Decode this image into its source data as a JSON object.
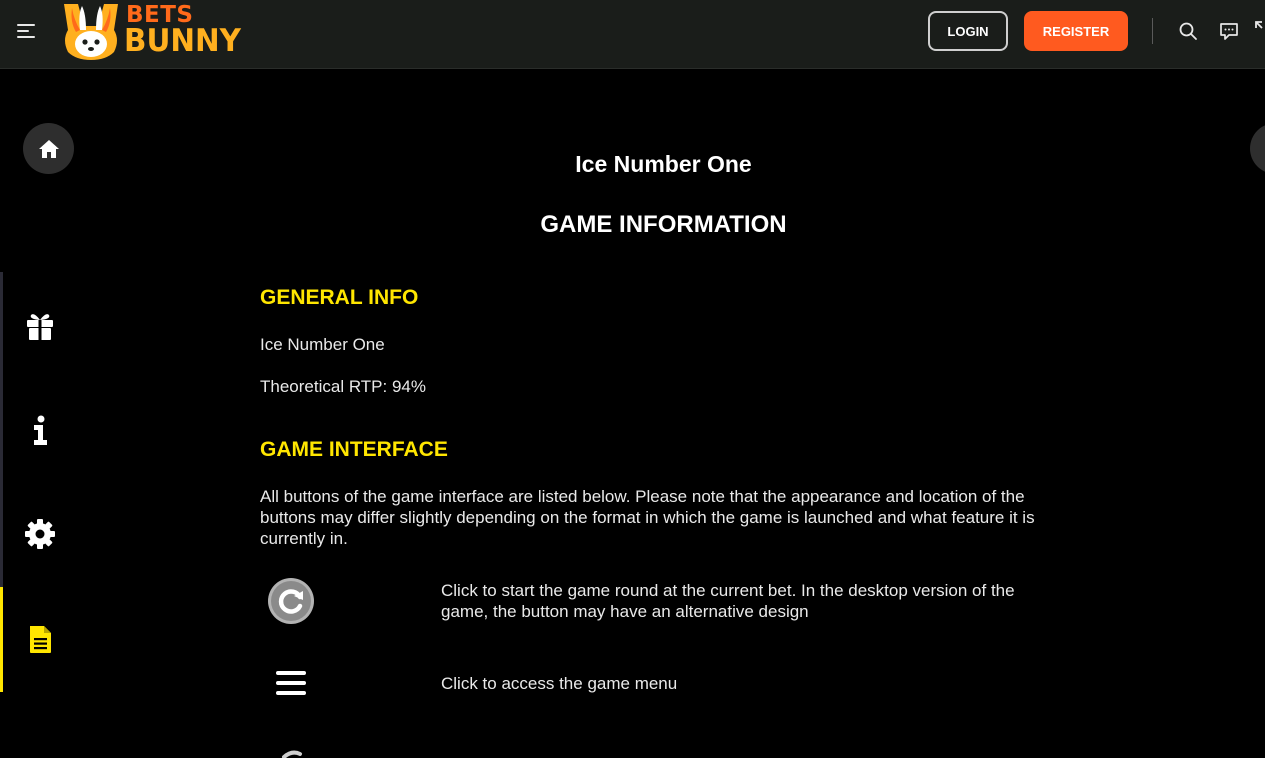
{
  "header": {
    "logo_top": "BETS",
    "logo_bottom": "BUNNY",
    "login_label": "LOGIN",
    "register_label": "REGISTER",
    "icons": [
      "menu-icon",
      "search-icon",
      "chat-icon",
      "expand-icon"
    ]
  },
  "sidebar": {
    "items": [
      {
        "icon": "home-icon"
      },
      {
        "icon": "gift-icon"
      },
      {
        "icon": "info-icon"
      },
      {
        "icon": "gear-icon"
      },
      {
        "icon": "document-icon",
        "active": true
      }
    ],
    "active_color": "#ffe600"
  },
  "content": {
    "title": "Ice Number One",
    "subtitle": "GAME INFORMATION",
    "general_info": {
      "heading": "GENERAL INFO",
      "game_name": "Ice Number One",
      "rtp": "Theoretical RTP: 94%"
    },
    "game_interface": {
      "heading": "GAME INTERFACE",
      "intro": "All buttons of the game interface are listed below. Please note that the appearance and location of the buttons may differ slightly depending on the format in which the game is launched and what feature it is currently in.",
      "buttons": [
        {
          "icon": "spin-icon",
          "description": "Click to start the game round at the current bet. In the desktop version of the game, the button may have an alternative design"
        },
        {
          "icon": "hamburger-menu-icon",
          "description": "Click to access the game menu"
        }
      ]
    }
  },
  "colors": {
    "accent_yellow": "#ffe600",
    "register_orange": "#ff5a1f",
    "logo_orange": "#ff6a1a",
    "logo_gold": "#ffb01f"
  }
}
